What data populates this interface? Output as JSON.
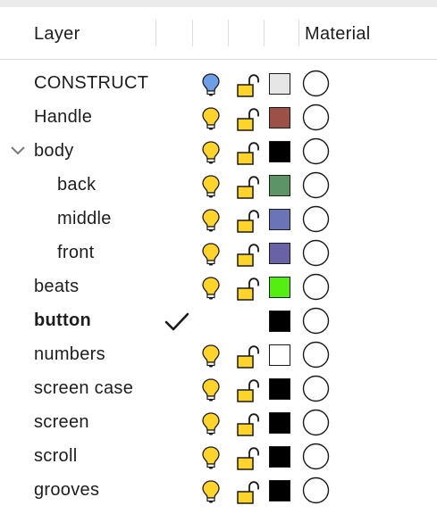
{
  "header": {
    "layer_label": "Layer",
    "material_label": "Material"
  },
  "colors": {
    "bulb_on": "#ffd42a",
    "bulb_current": "#6f9ee8",
    "lock": "#ffd42a"
  },
  "layers": [
    {
      "name": "CONSTRUCT",
      "indent": 0,
      "bold": false,
      "expanded": null,
      "current": false,
      "bulb": "current",
      "color": "#e6e6e6"
    },
    {
      "name": "Handle",
      "indent": 0,
      "bold": false,
      "expanded": null,
      "current": false,
      "bulb": "on",
      "color": "#9c5048"
    },
    {
      "name": "body",
      "indent": 0,
      "bold": false,
      "expanded": true,
      "current": false,
      "bulb": "on",
      "color": "#000000"
    },
    {
      "name": "back",
      "indent": 1,
      "bold": false,
      "expanded": null,
      "current": false,
      "bulb": "on",
      "color": "#5c9466"
    },
    {
      "name": "middle",
      "indent": 1,
      "bold": false,
      "expanded": null,
      "current": false,
      "bulb": "on",
      "color": "#6a74b6"
    },
    {
      "name": "front",
      "indent": 1,
      "bold": false,
      "expanded": null,
      "current": false,
      "bulb": "on",
      "color": "#6a62a6"
    },
    {
      "name": "beats",
      "indent": 0,
      "bold": false,
      "expanded": null,
      "current": false,
      "bulb": "on",
      "color": "#55ee11"
    },
    {
      "name": "button",
      "indent": 0,
      "bold": true,
      "expanded": null,
      "current": true,
      "bulb": "none",
      "color": "#000000"
    },
    {
      "name": "numbers",
      "indent": 0,
      "bold": false,
      "expanded": null,
      "current": false,
      "bulb": "on",
      "color": "#ffffff"
    },
    {
      "name": "screen case",
      "indent": 0,
      "bold": false,
      "expanded": null,
      "current": false,
      "bulb": "on",
      "color": "#000000"
    },
    {
      "name": "screen",
      "indent": 0,
      "bold": false,
      "expanded": null,
      "current": false,
      "bulb": "on",
      "color": "#000000"
    },
    {
      "name": "scroll",
      "indent": 0,
      "bold": false,
      "expanded": null,
      "current": false,
      "bulb": "on",
      "color": "#000000"
    },
    {
      "name": "grooves",
      "indent": 0,
      "bold": false,
      "expanded": null,
      "current": false,
      "bulb": "on",
      "color": "#000000"
    }
  ]
}
